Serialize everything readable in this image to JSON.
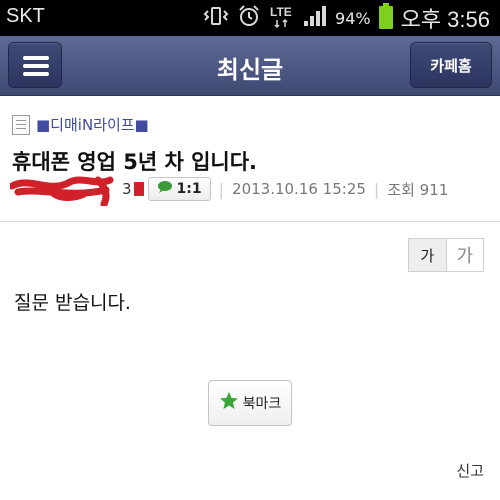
{
  "status_bar": {
    "carrier": "SKT",
    "network": "LTE",
    "battery_percent": "94%",
    "time": "오후 3:56",
    "icons": [
      "vibrate-icon",
      "alarm-icon",
      "lte-icon",
      "signal-icon",
      "battery-icon"
    ]
  },
  "header": {
    "title": "최신글",
    "menu_icon": "hamburger-icon",
    "cafe_home_label": "카페홈"
  },
  "post": {
    "board_name": "■디매iN라이프■",
    "title": "휴대폰 영업 5년 차 입니다.",
    "author_suffix": "3",
    "chat_label": "1:1",
    "date": "2013.10.16 15:25",
    "views": "조회 911",
    "body": "질문 받습니다."
  },
  "font_size": {
    "small_label": "가",
    "large_label": "가"
  },
  "bookmark_label": "북마크",
  "report_label": "신고",
  "colors": {
    "header_bg": "#4a5580",
    "board_name": "#3f4aa0",
    "redaction": "#d2202a",
    "bookmark_star": "#3aa53a",
    "chat_bubble": "#3a9a3a"
  }
}
